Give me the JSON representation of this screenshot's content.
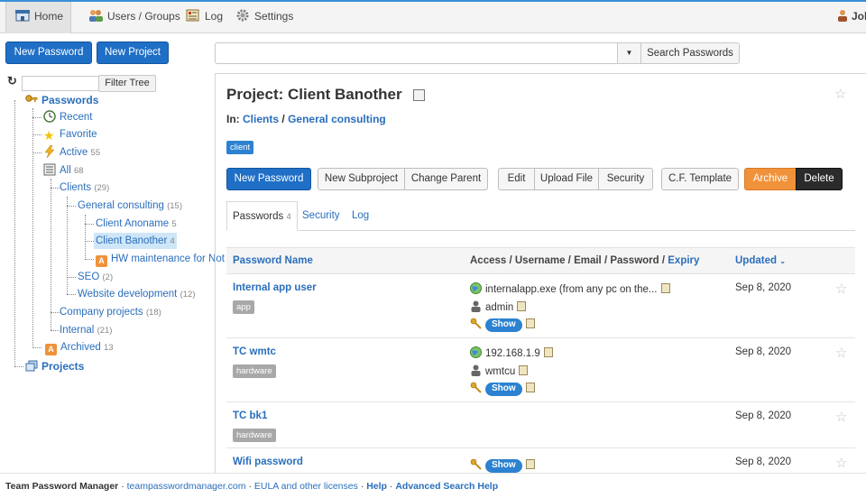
{
  "nav": {
    "home": "Home",
    "users_groups": "Users / Groups",
    "log": "Log",
    "settings": "Settings",
    "user": "Joh"
  },
  "toolbar": {
    "new_password": "New Password",
    "new_project": "New Project",
    "search_placeholder": "",
    "search_button": "Search Passwords"
  },
  "tree": {
    "filter_button": "Filter Tree",
    "root": "Passwords",
    "recent": "Recent",
    "favorite": "Favorite",
    "active": "Active",
    "active_count": "55",
    "all": "All",
    "all_count": "68",
    "clients": "Clients",
    "clients_count": "(29)",
    "general_consulting": "General consulting",
    "general_consulting_count": "(15)",
    "client_anoname": "Client Anoname",
    "client_anoname_count": "5",
    "client_banother": "Client Banother",
    "client_banother_count": "4",
    "hw_maintenance": "HW maintenance for Not",
    "seo": "SEO",
    "seo_count": "(2)",
    "website_dev": "Website development",
    "website_dev_count": "(12)",
    "company_projects": "Company projects",
    "company_projects_count": "(18)",
    "internal": "Internal",
    "internal_count": "(21)",
    "archived": "Archived",
    "archived_count": "13",
    "projects": "Projects"
  },
  "project": {
    "title": "Project: Client Banother",
    "in_label": "In:",
    "crumb_clients": "Clients",
    "crumb_sep": "/",
    "crumb_general": "General consulting",
    "tag": "client"
  },
  "actions": {
    "new_password": "New Password",
    "new_subproject": "New Subproject",
    "change_parent": "Change Parent",
    "edit": "Edit",
    "upload_file": "Upload File",
    "security": "Security",
    "cf_template": "C.F. Template",
    "archive": "Archive",
    "delete": "Delete"
  },
  "tabs": {
    "passwords": "Passwords",
    "passwords_count": "4",
    "security": "Security",
    "log": "Log"
  },
  "table": {
    "col_name": "Password Name",
    "col_access": "Access / Username / Email / Password / ",
    "col_expiry": "Expiry",
    "col_updated": "Updated",
    "rows": [
      {
        "name": "Internal app user",
        "tag": "app",
        "access": "internalapp.exe (from any pc on the...",
        "username": "admin",
        "show": "Show",
        "updated": "Sep 8, 2020"
      },
      {
        "name": "TC wmtc",
        "tag": "hardware",
        "access": "192.168.1.9",
        "username": "wmtcu",
        "show": "Show",
        "updated": "Sep 8, 2020"
      },
      {
        "name": "TC bk1",
        "tag": "hardware",
        "updated": "Sep 8, 2020"
      },
      {
        "name": "Wifi password",
        "show": "Show",
        "updated": "Sep 8, 2020"
      }
    ]
  },
  "footer": {
    "app_name": "Team Password Manager",
    "site": "teampasswordmanager.com",
    "eula": "EULA and other licenses",
    "help": "Help",
    "advanced_search_help": "Advanced Search Help",
    "sep": " · "
  },
  "colors": {
    "primary": "#1f6fc6",
    "link": "#2a6ebb",
    "archive": "#f0923a",
    "delete": "#2b2b2b"
  }
}
